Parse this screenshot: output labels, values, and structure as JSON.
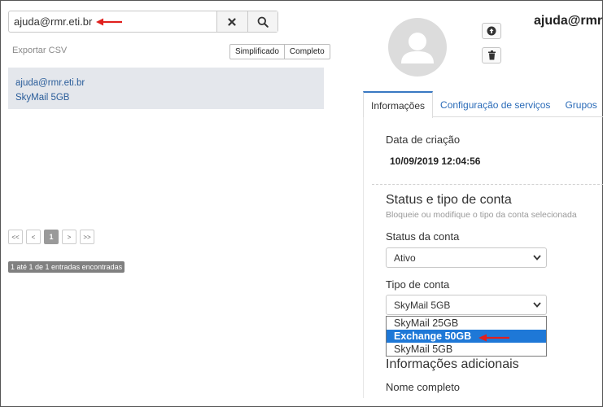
{
  "search": {
    "value": "ajuda@rmr.eti.br",
    "clear_icon": "close-icon",
    "search_icon": "search-icon"
  },
  "list": {
    "export_label": "Exportar CSV",
    "view_simplified": "Simplificado",
    "view_complete": "Completo",
    "results": [
      {
        "email": "ajuda@rmr.eti.br",
        "plan": "SkyMail 5GB"
      }
    ],
    "pagination": {
      "first": "<<",
      "prev": "<",
      "current": "1",
      "next": ">",
      "last": ">>"
    },
    "entries_text": "1 até 1 de 1 entradas encontradas"
  },
  "profile": {
    "title": "ajuda@rmr",
    "tabs": [
      {
        "label": "Informações",
        "active": true
      },
      {
        "label": "Configuração de serviços",
        "active": false
      },
      {
        "label": "Grupos",
        "active": false
      }
    ],
    "creation_label": "Data de criação",
    "creation_value": "10/09/2019 12:04:56",
    "status_section_title": "Status e tipo de conta",
    "status_section_helper": "Bloqueie ou modifique o tipo da conta selecionada",
    "status_label": "Status da conta",
    "status_value": "Ativo",
    "type_label": "Tipo de conta",
    "type_value": "SkyMail 5GB",
    "type_options": [
      "SkyMail 25GB",
      "Exchange 50GB",
      "SkyMail 5GB"
    ],
    "type_highlighted_option": "Exchange 50GB",
    "additional_section_title": "Informações adicionais",
    "fullname_label": "Nome completo"
  },
  "colors": {
    "annotation_arrow": "#e0201e",
    "highlight": "#1e78d7",
    "link": "#2a6bb8"
  }
}
